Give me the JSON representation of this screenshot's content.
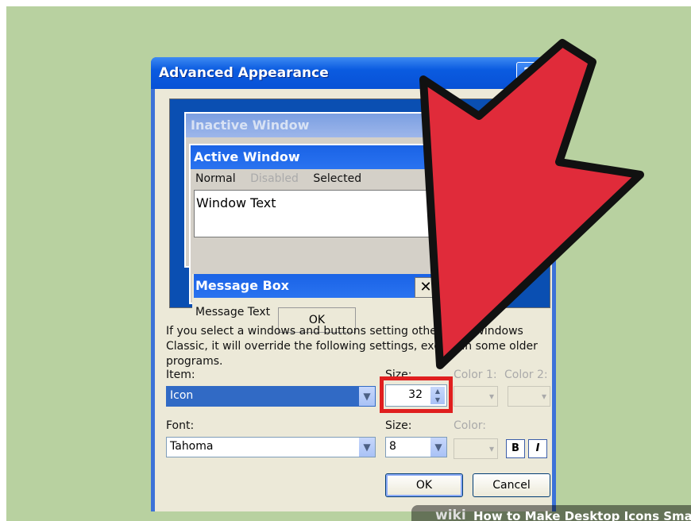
{
  "dialog": {
    "title": "Advanced Appearance",
    "help": "?"
  },
  "preview": {
    "inactive_window": "Inactive Window",
    "inactive_close": "✕",
    "active_window": "Active Window",
    "menu_normal": "Normal",
    "menu_disabled": "Disabled",
    "menu_selected": "Selected",
    "window_text": "Window Text",
    "message_box": "Message Box",
    "message_close": "✕",
    "message_text": "Message Text",
    "message_ok": "OK"
  },
  "info_text": "If you select a windows and buttons setting other than Windows Classic, it will override the following settings, except in some older programs.",
  "item": {
    "label": "Item:",
    "value": "Icon",
    "size_label": "Size:",
    "size_value": "32",
    "color1_label": "Color 1:",
    "color2_label": "Color 2:"
  },
  "font": {
    "label": "Font:",
    "value": "Tahoma",
    "size_label": "Size:",
    "size_value": "8",
    "color_label": "Color:",
    "bold": "B",
    "italic": "I"
  },
  "buttons": {
    "ok": "OK",
    "cancel": "Cancel"
  },
  "watermark": {
    "brand": "wiki",
    "title": "How to Make Desktop Icons Smaller"
  },
  "colors": {
    "highlight_box": "#e01f1f",
    "arrow": "#e02b3a"
  }
}
